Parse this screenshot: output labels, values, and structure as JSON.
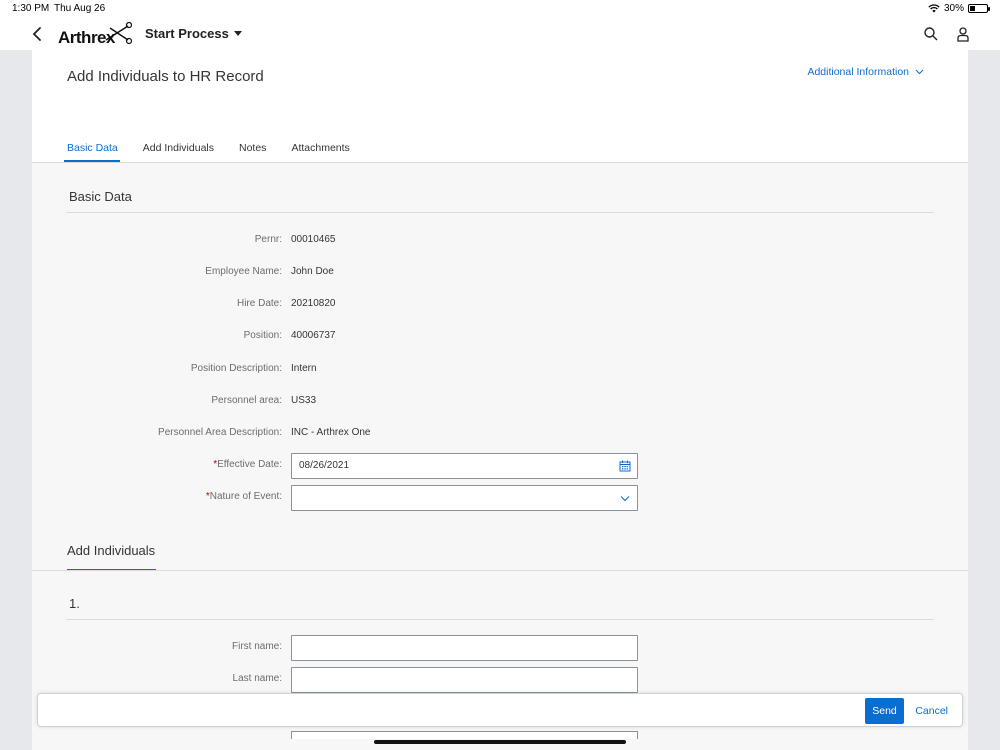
{
  "status_bar": {
    "time": "1:30 PM",
    "date": "Thu Aug 26",
    "battery": "30%",
    "battery_level": 0.3
  },
  "app_header": {
    "logo_text": "Arthrex",
    "menu_title": "Start Process",
    "icons": [
      "back-chevron-icon",
      "search-icon",
      "user-icon"
    ]
  },
  "page": {
    "title": "Add Individuals to HR Record",
    "additional_info": "Additional Information",
    "tabs": [
      {
        "label": "Basic Data",
        "active": true
      },
      {
        "label": "Add Individuals",
        "active": false
      },
      {
        "label": "Notes",
        "active": false
      },
      {
        "label": "Attachments",
        "active": false
      }
    ]
  },
  "basic_data": {
    "section_title": "Basic Data",
    "fields": [
      {
        "label": "Pernr:",
        "value": "00010465"
      },
      {
        "label": "Employee Name:",
        "value": "John Doe"
      },
      {
        "label": "Hire Date:",
        "value": "20210820"
      },
      {
        "label": "Position:",
        "value": "40006737"
      },
      {
        "label": "Position Description:",
        "value": "Intern"
      },
      {
        "label": "Personnel area:",
        "value": "US33"
      },
      {
        "label": "Personnel Area Description:",
        "value": "INC - Arthrex One"
      }
    ],
    "effective_date": {
      "required_mark": "*",
      "label": "Effective Date:",
      "value": "08/26/2021"
    },
    "nature_of_event": {
      "required_mark": "*",
      "label": "Nature of Event:",
      "value": ""
    }
  },
  "add_individuals": {
    "section_title": "Add Individuals",
    "entry_number": "1.",
    "first_name": {
      "label": "First name:",
      "value": ""
    },
    "last_name": {
      "label": "Last name:",
      "value": ""
    }
  },
  "footer": {
    "send_label": "Send",
    "cancel_label": "Cancel"
  },
  "colors": {
    "accent": "#0a6ed1",
    "required": "#bb0000",
    "background": "#e6e8eb"
  }
}
